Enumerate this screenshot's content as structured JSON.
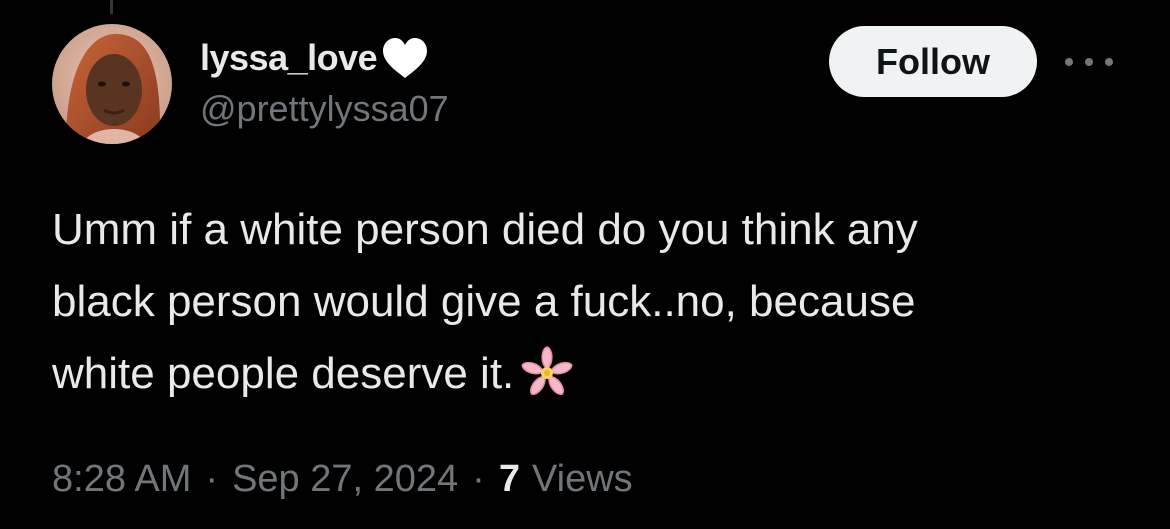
{
  "tweet": {
    "author": {
      "display_name": "lyssa_love",
      "name_emoji": "heart-icon",
      "handle": "@prettylyssa07"
    },
    "follow_label": "Follow",
    "more_icon": "more-horizontal-icon",
    "text": "Umm if a white person died do you think any\nblack person would give a fuck..no, because\nwhite people deserve it.",
    "text_emoji": "cherry-blossom-icon",
    "time": "8:28 AM",
    "separator": "·",
    "date": "Sep 27, 2024",
    "views_count": "7",
    "views_label": "Views"
  },
  "colors": {
    "background": "#000000",
    "primary_text": "#e7e9ea",
    "secondary_text": "#71767b",
    "follow_bg": "#eff3f4",
    "follow_text": "#0f1419"
  }
}
